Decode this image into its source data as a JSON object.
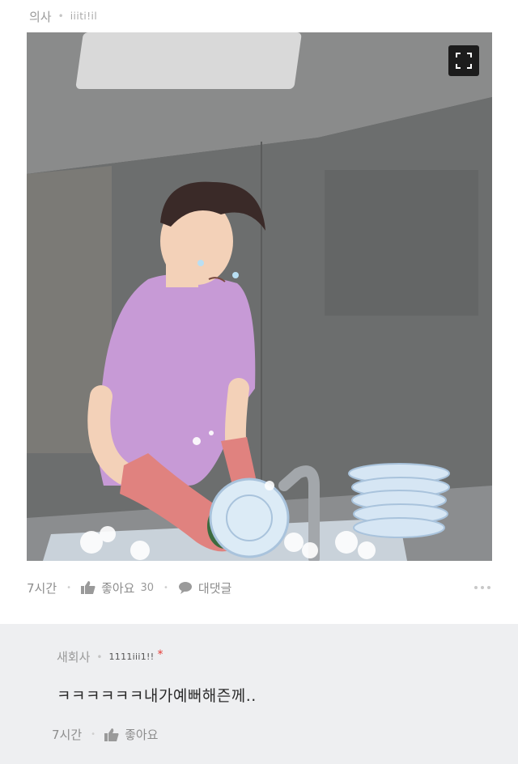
{
  "post": {
    "job": "의사",
    "author": "iiiti!il",
    "time": "7시간",
    "like_label": "좋아요",
    "like_count": "30",
    "comment_label": "대댓글"
  },
  "image": {
    "palette": {
      "wall": "#6e7070",
      "ceiling": "#8a8b8b",
      "shirt": "#c79ad6",
      "glove": "#e0827f",
      "hair": "#3a2a28",
      "skin": "#f3d1b8",
      "plates": "#d6e6f4"
    }
  },
  "comment": {
    "job": "새회사",
    "author": "1111iii1!!",
    "text": "ㅋㅋㅋㅋㅋㅋ내가예뻐해즌께..",
    "time": "7시간",
    "like_label": "좋아요"
  }
}
